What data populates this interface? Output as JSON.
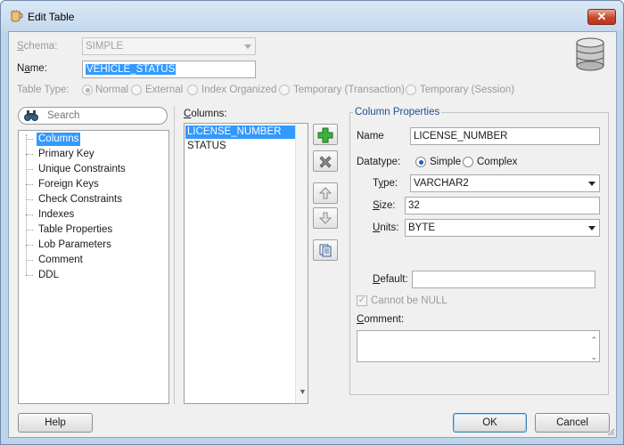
{
  "window": {
    "title": "Edit Table",
    "close_label": "✕"
  },
  "form": {
    "schema_label": "Schema:",
    "schema_value": "SIMPLE",
    "name_label": "Name:",
    "name_value": "VEHICLE_STATUS",
    "table_type_label": "Table Type:",
    "table_types": [
      "Normal",
      "External",
      "Index Organized",
      "Temporary (Transaction)",
      "Temporary (Session)"
    ],
    "selected_table_type": "Normal"
  },
  "search": {
    "placeholder": "Search",
    "icon": "binoculars-icon"
  },
  "nav": {
    "items": [
      "Columns",
      "Primary Key",
      "Unique Constraints",
      "Foreign Keys",
      "Check Constraints",
      "Indexes",
      "Table Properties",
      "Lob Parameters",
      "Comment",
      "DDL"
    ],
    "selected": "Columns"
  },
  "columns": {
    "label": "Columns:",
    "items": [
      "LICENSE_NUMBER",
      "STATUS"
    ],
    "selected": "LICENSE_NUMBER"
  },
  "toolbar": {
    "add_icon": "plus-icon",
    "remove_icon": "x-icon",
    "up_icon": "arrow-up-icon",
    "down_icon": "arrow-down-icon",
    "copy_icon": "copy-icon"
  },
  "properties": {
    "legend": "Column Properties",
    "name_label": "Name",
    "name_value": "LICENSE_NUMBER",
    "datatype_label": "Datatype:",
    "datatype_options": [
      "Simple",
      "Complex"
    ],
    "datatype_selected": "Simple",
    "type_label": "Type:",
    "type_value": "VARCHAR2",
    "size_label": "Size:",
    "size_value": "32",
    "units_label": "Units:",
    "units_value": "BYTE",
    "default_label": "Default:",
    "default_value": "",
    "not_null_label": "Cannot be NULL",
    "not_null_checked": true,
    "comment_label": "Comment:",
    "comment_value": ""
  },
  "footer": {
    "help_label": "Help",
    "ok_label": "OK",
    "cancel_label": "Cancel"
  },
  "colors": {
    "selection": "#3399ff",
    "titlebar": "#c4d8ee",
    "legend_text": "#1f4e8f",
    "add_green": "#2e9b2e"
  }
}
